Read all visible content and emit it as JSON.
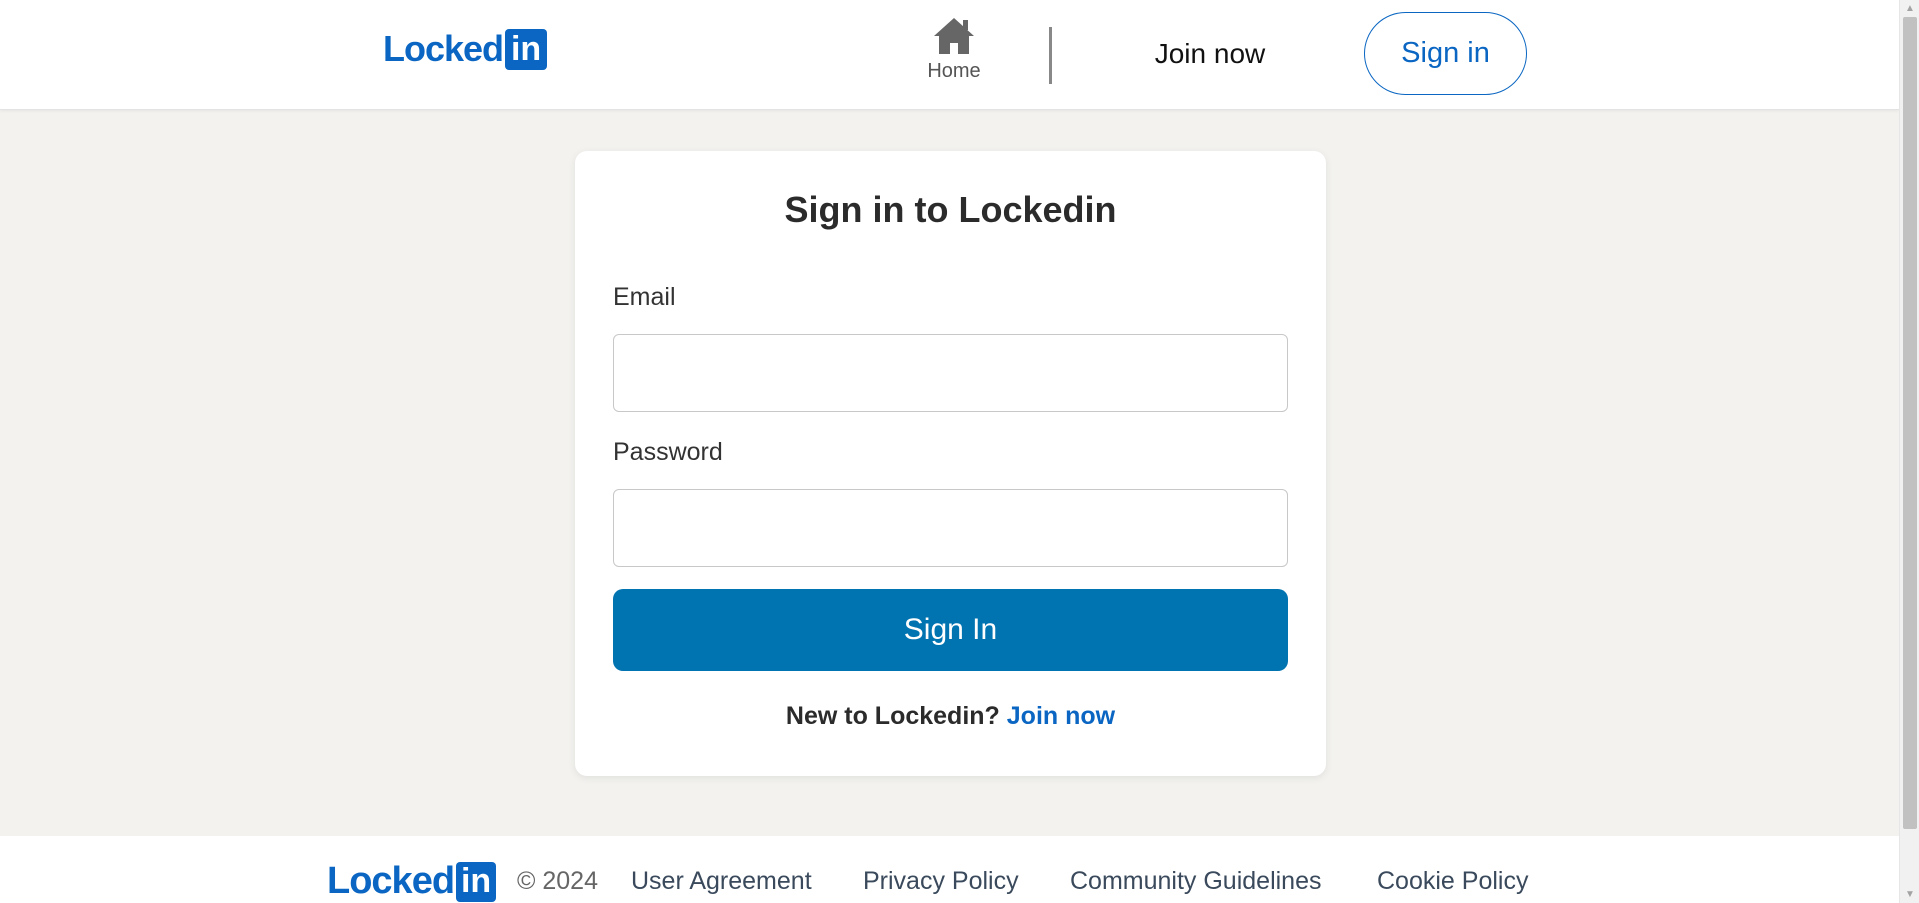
{
  "header": {
    "logo": {
      "word": "Locked",
      "box": "in"
    },
    "nav": {
      "home_icon": "home-icon",
      "home_label": "Home",
      "join_label": "Join now",
      "signin_label": "Sign in"
    }
  },
  "form": {
    "title": "Sign in to Lockedin",
    "email_label": "Email",
    "email_value": "",
    "password_label": "Password",
    "password_value": "",
    "submit_label": "Sign In",
    "new_user_text": "New to Lockedin?",
    "new_user_link": "Join now"
  },
  "footer": {
    "logo": {
      "word": "Locked",
      "box": "in"
    },
    "copyright": "© 2024",
    "links": [
      "User Agreement",
      "Privacy Policy",
      "Community Guidelines",
      "Cookie Policy"
    ]
  },
  "colors": {
    "brand": "#0a66c2",
    "button": "#0073b1",
    "page_background": "#f3f2ef"
  }
}
